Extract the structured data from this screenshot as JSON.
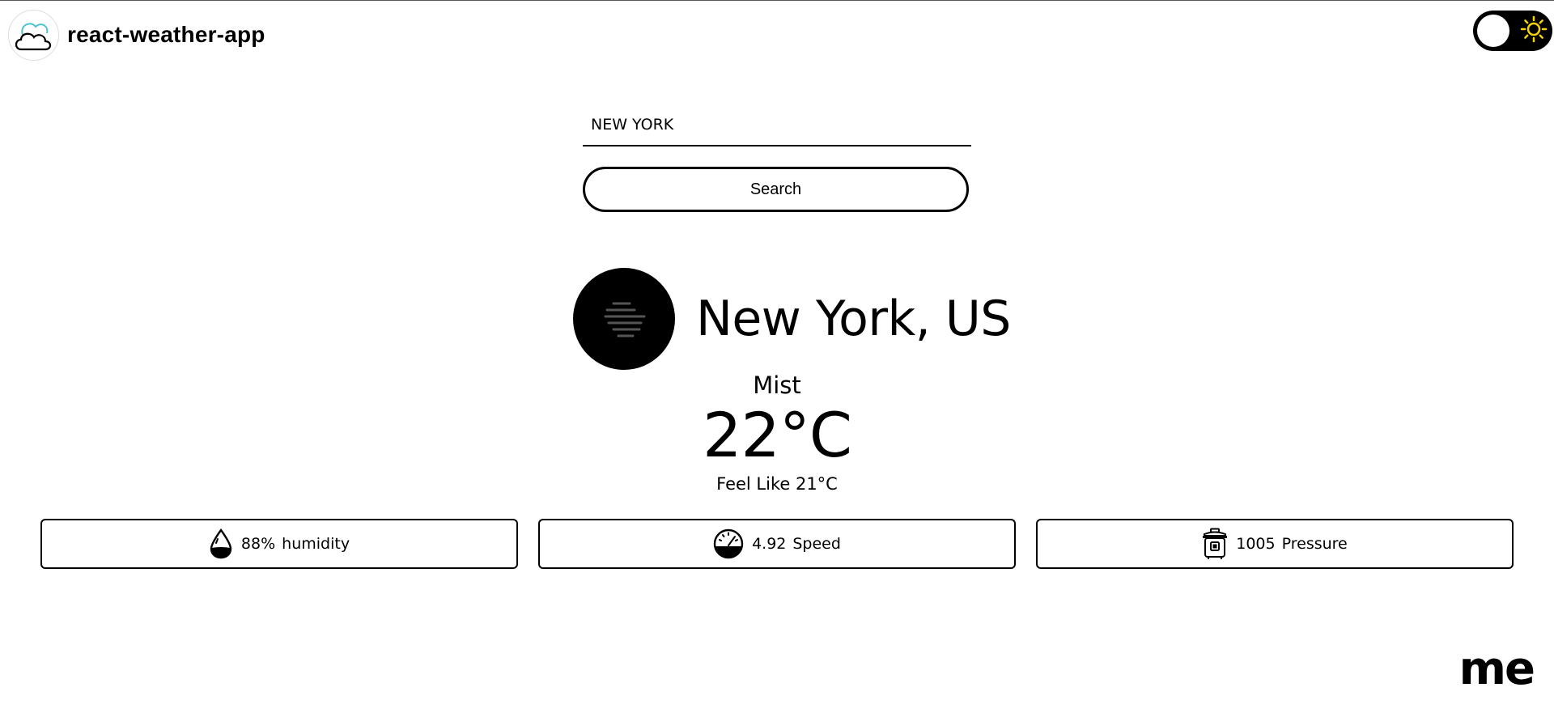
{
  "header": {
    "app_title": "react-weather-app",
    "logo_icon": "cloud-icon",
    "theme_toggle_icon": "sun-icon",
    "theme_toggle_icon_color": "#f5d400"
  },
  "search": {
    "value": "NEW YORK",
    "button_label": "Search"
  },
  "weather": {
    "icon": "mist-icon",
    "city": "New York, US",
    "condition": "Mist",
    "temperature": "22°C",
    "feels_like": "Feel Like 21°C"
  },
  "stats": [
    {
      "icon": "water-drop-icon",
      "value": "88%",
      "label": "humidity"
    },
    {
      "icon": "speedometer-icon",
      "value": "4.92",
      "label": "Speed"
    },
    {
      "icon": "pressure-cooker-icon",
      "value": "1005",
      "label": "Pressure"
    }
  ],
  "footer": {
    "signature": "me"
  }
}
